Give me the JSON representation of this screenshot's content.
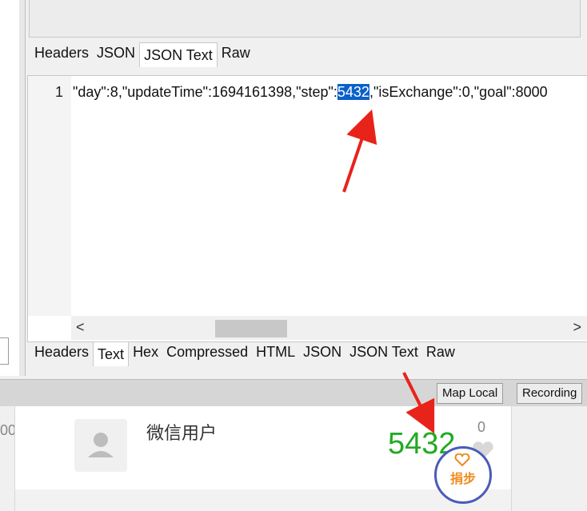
{
  "top_tabs": [
    "Headers",
    "JSON",
    "JSON Text",
    "Raw"
  ],
  "top_tabs_selected": "JSON Text",
  "editor": {
    "line_number": "1",
    "code_before": "\"day\":8,\"updateTime\":1694161398,\"step\":",
    "code_highlight": "5432",
    "code_after": ",\"isExchange\":0,\"goal\":8000"
  },
  "scroll": {
    "left_arrow": "<",
    "right_arrow": ">"
  },
  "bottom_tabs": [
    "Headers",
    "Text",
    "Hex",
    "Compressed",
    "HTML",
    "JSON",
    "JSON Text",
    "Raw"
  ],
  "bottom_tabs_selected": "Text",
  "status_bar": {
    "map_local": "Map Local",
    "recording": "Recording"
  },
  "card": {
    "username": "微信用户",
    "steps": "5432",
    "likes": "0",
    "donate_label": "捐步",
    "left_fragment": "00"
  },
  "colors": {
    "highlight": "#0a60c8",
    "steps_green": "#22aa22",
    "arrow_red": "#e8231a",
    "donate_ring": "#4a5bb8"
  },
  "icons": [
    "avatar-placeholder-icon",
    "heart-icon",
    "scroll-left-icon",
    "scroll-right-icon"
  ]
}
